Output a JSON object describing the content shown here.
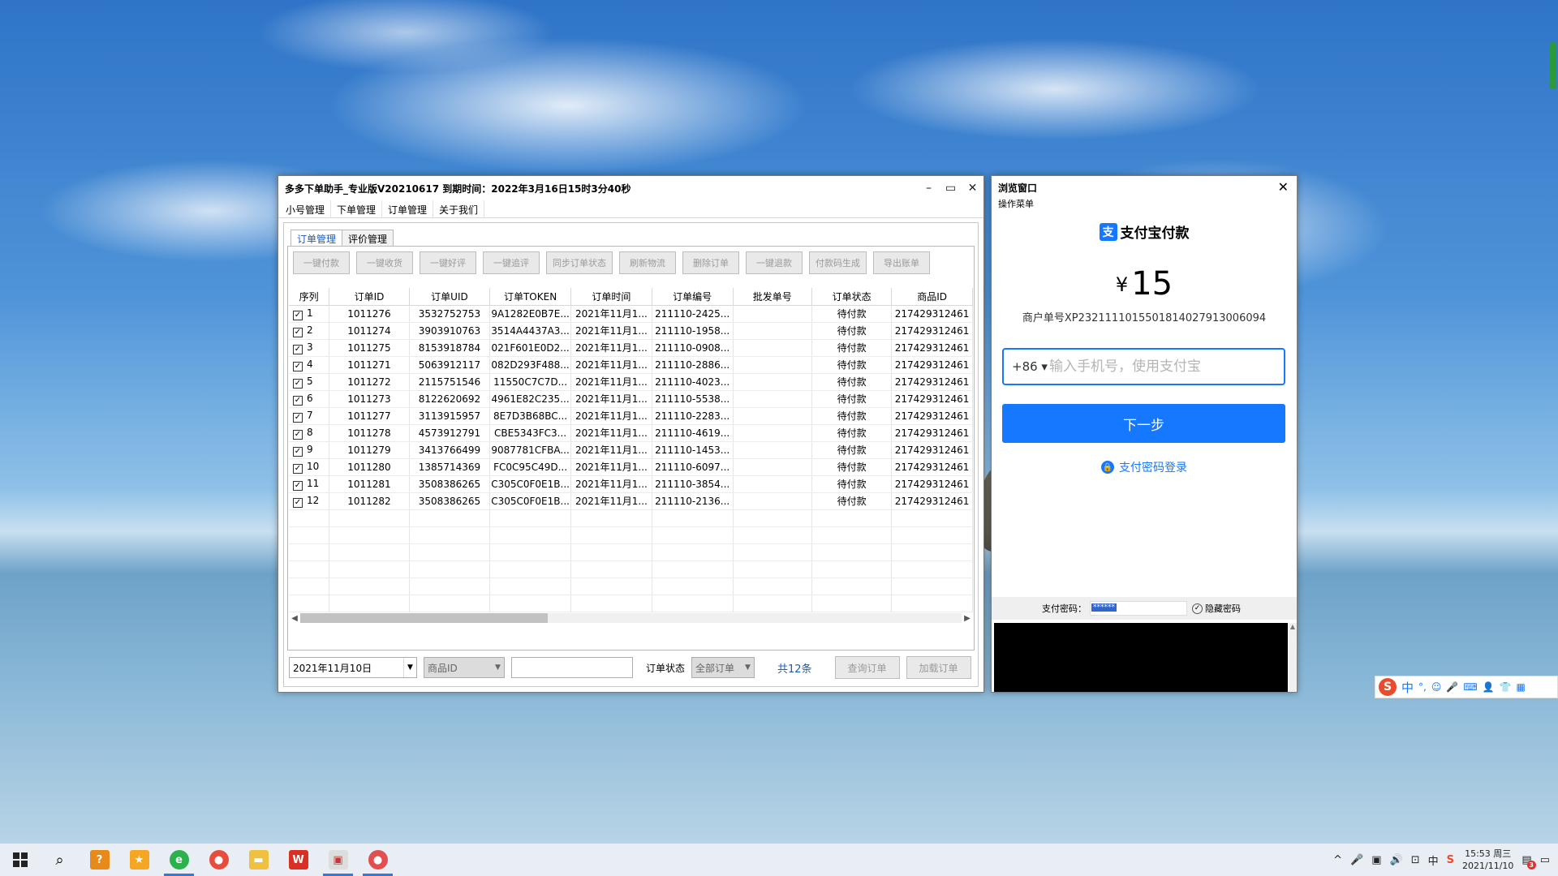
{
  "main_window": {
    "title": "多多下单助手_专业版V20210617  到期时间：2022年3月16日15时3分40秒",
    "controls": {
      "minimize": "–",
      "maximize": "▭",
      "close": "✕"
    },
    "menu": [
      "小号管理",
      "下单管理",
      "订单管理",
      "关于我们"
    ],
    "tabs": [
      "订单管理",
      "评价管理"
    ],
    "toolbar": [
      "一键付款",
      "一键收货",
      "一键好评",
      "一键追评",
      "同步订单状态",
      "刷新物流",
      "删除订单",
      "一键退款",
      "付款码生成",
      "导出账单"
    ],
    "table": {
      "columns": [
        "序列",
        "订单ID",
        "订单UID",
        "订单TOKEN",
        "订单时间",
        "订单编号",
        "批发单号",
        "订单状态",
        "商品ID"
      ],
      "rows": [
        [
          "1",
          "1011276",
          "3532752753",
          "9A1282E0B7E...",
          "2021年11月1...",
          "211110-2425...",
          "",
          "待付款",
          "217429312461"
        ],
        [
          "2",
          "1011274",
          "3903910763",
          "3514A4437A3...",
          "2021年11月1...",
          "211110-1958...",
          "",
          "待付款",
          "217429312461"
        ],
        [
          "3",
          "1011275",
          "8153918784",
          "021F601E0D2...",
          "2021年11月1...",
          "211110-0908...",
          "",
          "待付款",
          "217429312461"
        ],
        [
          "4",
          "1011271",
          "5063912117",
          "082D293F488...",
          "2021年11月1...",
          "211110-2886...",
          "",
          "待付款",
          "217429312461"
        ],
        [
          "5",
          "1011272",
          "2115751546",
          "11550C7C7D...",
          "2021年11月1...",
          "211110-4023...",
          "",
          "待付款",
          "217429312461"
        ],
        [
          "6",
          "1011273",
          "8122620692",
          "4961E82C235...",
          "2021年11月1...",
          "211110-5538...",
          "",
          "待付款",
          "217429312461"
        ],
        [
          "7",
          "1011277",
          "3113915957",
          "8E7D3B68BC...",
          "2021年11月1...",
          "211110-2283...",
          "",
          "待付款",
          "217429312461"
        ],
        [
          "8",
          "1011278",
          "4573912791",
          "CBE5343FC3...",
          "2021年11月1...",
          "211110-4619...",
          "",
          "待付款",
          "217429312461"
        ],
        [
          "9",
          "1011279",
          "3413766499",
          "9087781CFBA...",
          "2021年11月1...",
          "211110-1453...",
          "",
          "待付款",
          "217429312461"
        ],
        [
          "10",
          "1011280",
          "1385714369",
          "FC0C95C49D...",
          "2021年11月1...",
          "211110-6097...",
          "",
          "待付款",
          "217429312461"
        ],
        [
          "11",
          "1011281",
          "3508386265",
          "C305C0F0E1B...",
          "2021年11月1...",
          "211110-3854...",
          "",
          "待付款",
          "217429312461"
        ],
        [
          "12",
          "1011282",
          "3508386265",
          "C305C0F0E1B...",
          "2021年11月1...",
          "211110-2136...",
          "",
          "待付款",
          "217429312461"
        ]
      ],
      "empty_rows": 7
    },
    "bottom": {
      "date": "2021年11月10日",
      "field_select": "商品ID",
      "search_value": "",
      "status_label": "订单状态",
      "status_select": "全部订单",
      "count": "共12条",
      "query_button": "查询订单",
      "load_button": "加载订单"
    }
  },
  "browser": {
    "title": "浏览窗口",
    "menu": "操作菜单",
    "close": "✕",
    "alipay_logo": "支",
    "alipay_title": "支付宝付款",
    "currency": "¥",
    "amount": "15",
    "merchant": "商户单号XP232111101550181402791300609​4",
    "country_code": "+86 ▾",
    "phone_placeholder": "输入手机号，使用支付宝",
    "next_button": "下一步",
    "password_login": "支付密码登录",
    "pwd_label": "支付密码：",
    "pwd_value": "******",
    "hide_pwd": "隐藏密码"
  },
  "ime": {
    "logo": "S",
    "mode": "中",
    "icons": [
      "°,",
      "☺",
      "🎤",
      "⌨",
      "👤",
      "👕",
      "▦"
    ]
  },
  "taskbar": {
    "time": "15:53 周三",
    "date": "2021/11/10",
    "tray_icons": [
      "^",
      "🎤",
      "▣",
      "🔊",
      "⊡",
      "中",
      "S"
    ]
  },
  "colors": {
    "accent": "#1677ff",
    "link": "#1c5bb5"
  }
}
